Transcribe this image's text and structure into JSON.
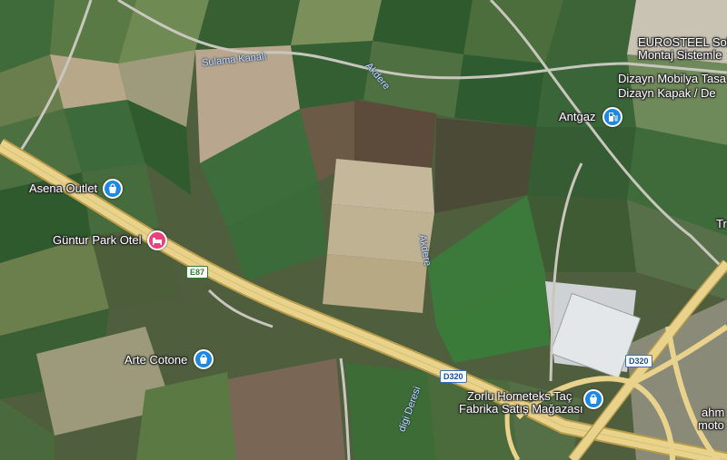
{
  "map": {
    "type": "satellite",
    "places": {
      "asena_outlet": "Asena Outlet",
      "guntur_park_otel": "Güntur Park Otel",
      "arte_cotone": "Arte Cotone",
      "antgaz": "Antgaz",
      "zorlu_line1": "Zorlu Hometeks Taç",
      "zorlu_line2": "Fabrika Satış Mağazası",
      "eurosteel_line1": "EUROSTEEL Sol",
      "eurosteel_line2": "Montaj Sistemle",
      "dizayn_line1": "Dizayn Mobilya Tasa",
      "dizayn_line2": "Dizayn Kapak / De",
      "tr_partial": "Tr",
      "ahmo_line1": "ahm",
      "ahmo_line2": "moto"
    },
    "waterways": {
      "sulama_kanali": "Sulama Kanalı",
      "akdere_upper": "Akdere",
      "akdere_middle": "Akdere",
      "deresi": "digi Deresi"
    },
    "roads": {
      "e87": "E87",
      "d320_center": "D320",
      "d320_right": "D320"
    },
    "colors": {
      "highway": "#e8d28c",
      "shopping_pin": "#1e88e5",
      "hotel_pin": "#ec407a",
      "gas_pin": "#1e88e5"
    },
    "icons": {
      "shopping": "shopping-bag-icon",
      "hotel": "bed-icon",
      "gas": "gas-pump-icon"
    }
  }
}
